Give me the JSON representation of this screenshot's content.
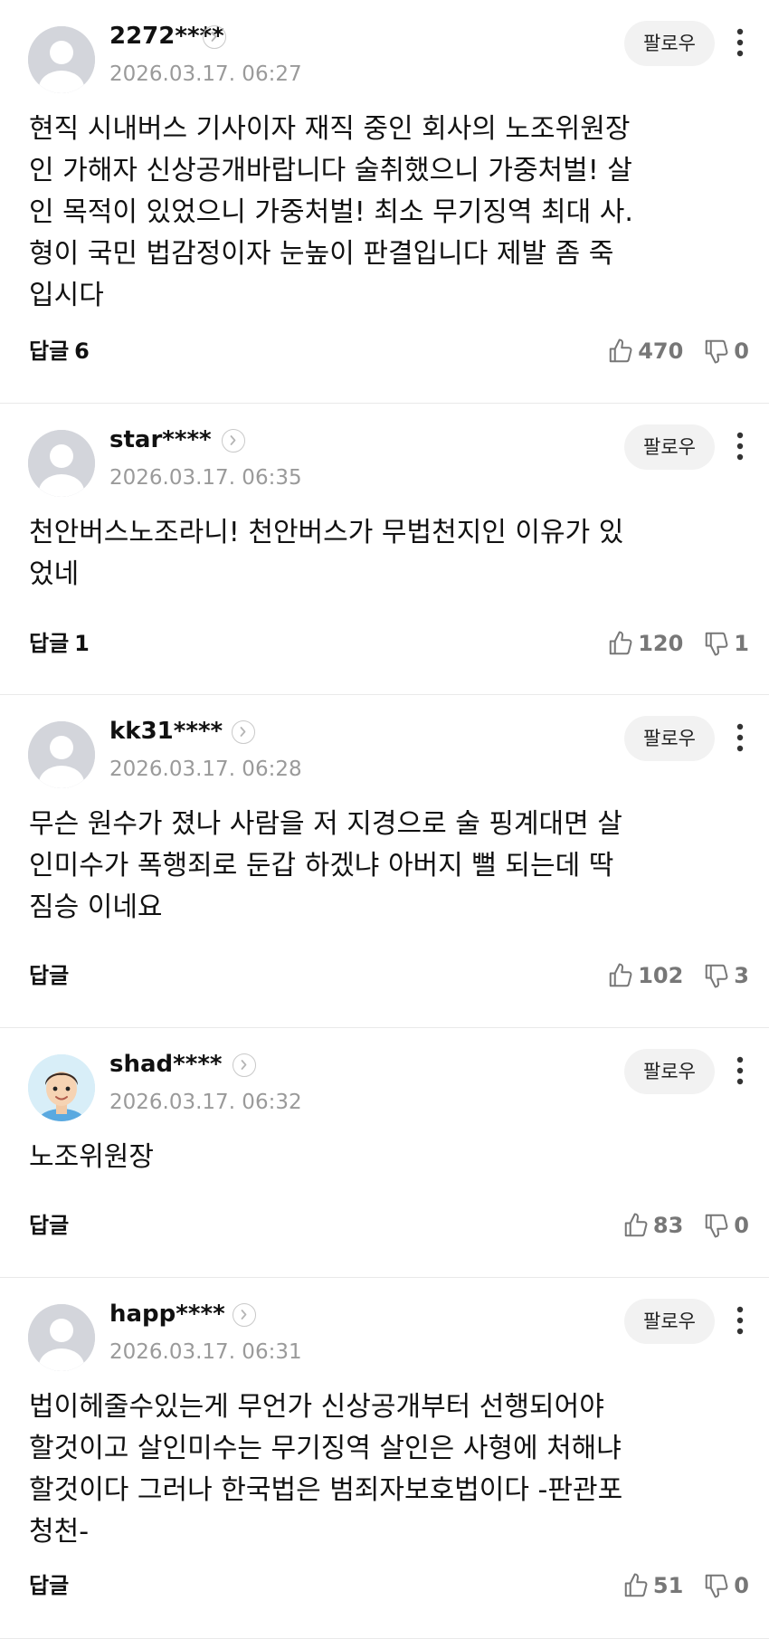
{
  "comments": [
    {
      "username": "2272****",
      "timestamp": "2026.03.17. 06:27",
      "follow_label": "팔로우",
      "avatar": "default-avatar",
      "text": "현직 시내버스 기사이자 재직 중인 회사의 노조위원장\n인 가해자 신상공개바랍니다 술취했으니 가중처벌! 살\n인 목적이 있었으니 가중처벌! 최소 무기징역 최대 사.\n형이 국민 법감정이자 눈높이 판결입니다 제발 좀 죽\n입시다",
      "reply_label": "답글",
      "reply_count": "6",
      "likes": "470",
      "dislikes": "0"
    },
    {
      "username": "star****",
      "timestamp": "2026.03.17. 06:35",
      "follow_label": "팔로우",
      "avatar": "default-avatar",
      "text": "천안버스노조라니! 천안버스가 무법천지인 이유가 있\n었네",
      "reply_label": "답글",
      "reply_count": "1",
      "likes": "120",
      "dislikes": "1"
    },
    {
      "username": "kk31****",
      "timestamp": "2026.03.17. 06:28",
      "follow_label": "팔로우",
      "avatar": "default-avatar",
      "text": "무슨 원수가 졌나 사람을 저 지경으로 술 핑계대면 살\n인미수가 폭행죄로 둔갑 하겠냐 아버지 뻘 되는데 딱\n짐승 이네요",
      "reply_label": "답글",
      "reply_count": "",
      "likes": "102",
      "dislikes": "3"
    },
    {
      "username": "shad****",
      "timestamp": "2026.03.17. 06:32",
      "follow_label": "팔로우",
      "avatar": "character-avatar",
      "text": "노조위원장",
      "reply_label": "답글",
      "reply_count": "",
      "likes": "83",
      "dislikes": "0"
    },
    {
      "username": "happ****",
      "timestamp": "2026.03.17. 06:31",
      "follow_label": "팔로우",
      "avatar": "default-avatar",
      "text": "법이헤줄수있는게 무언가 신상공개부터 선행되어야\n할것이고 살인미수는 무기징역 살인은 사형에 처해냐\n할것이다 그러나 한국법은 범죄자보호법이다 -판관포\n청천-",
      "reply_label": "답글",
      "reply_count": "",
      "likes": "51",
      "dislikes": "0"
    }
  ],
  "icons": {
    "profile_arrow": "chevron-right-icon",
    "more": "more-vertical-icon",
    "like": "thumbs-up-icon",
    "dislike": "thumbs-down-icon"
  },
  "colors": {
    "text": "#111111",
    "muted": "#9a9a9a",
    "count": "#777777",
    "follow_bg": "#f2f2f2",
    "divider": "#e9e9e9"
  }
}
